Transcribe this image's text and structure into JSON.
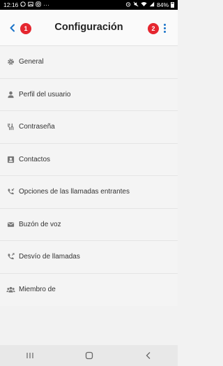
{
  "status_bar": {
    "time": "12:16",
    "more_indicator": "···",
    "battery": "84%",
    "battery_level_percent": 84,
    "left_icons": [
      "whatsapp-icon",
      "gallery-icon",
      "instagram-icon"
    ],
    "right_icons": [
      "alarm-icon",
      "mute-icon",
      "wifi-icon",
      "signal-icon",
      "battery-icon"
    ]
  },
  "app_bar": {
    "title": "Configuración",
    "back_icon": "chevron-left-icon",
    "more_icon": "more-vert-icon",
    "badge_1": "1",
    "badge_2": "2",
    "accent_color": "#1a73c8",
    "badge_color": "#e5262f"
  },
  "menu": {
    "items": [
      {
        "label": "General",
        "icon": "gear-icon"
      },
      {
        "label": "Perfil del usuario",
        "icon": "person-icon"
      },
      {
        "label": "Contraseña",
        "icon": "key-icon"
      },
      {
        "label": "Contactos",
        "icon": "contact-card-icon"
      },
      {
        "label": "Opciones de las llamadas entrantes",
        "icon": "incoming-call-icon"
      },
      {
        "label": "Buzón de voz",
        "icon": "voicemail-icon"
      },
      {
        "label": "Desvío de llamadas",
        "icon": "call-forward-icon"
      },
      {
        "label": "Miembro de",
        "icon": "group-icon"
      }
    ]
  },
  "nav_bar": {
    "buttons": [
      "recent-apps-icon",
      "home-icon",
      "back-icon"
    ]
  }
}
